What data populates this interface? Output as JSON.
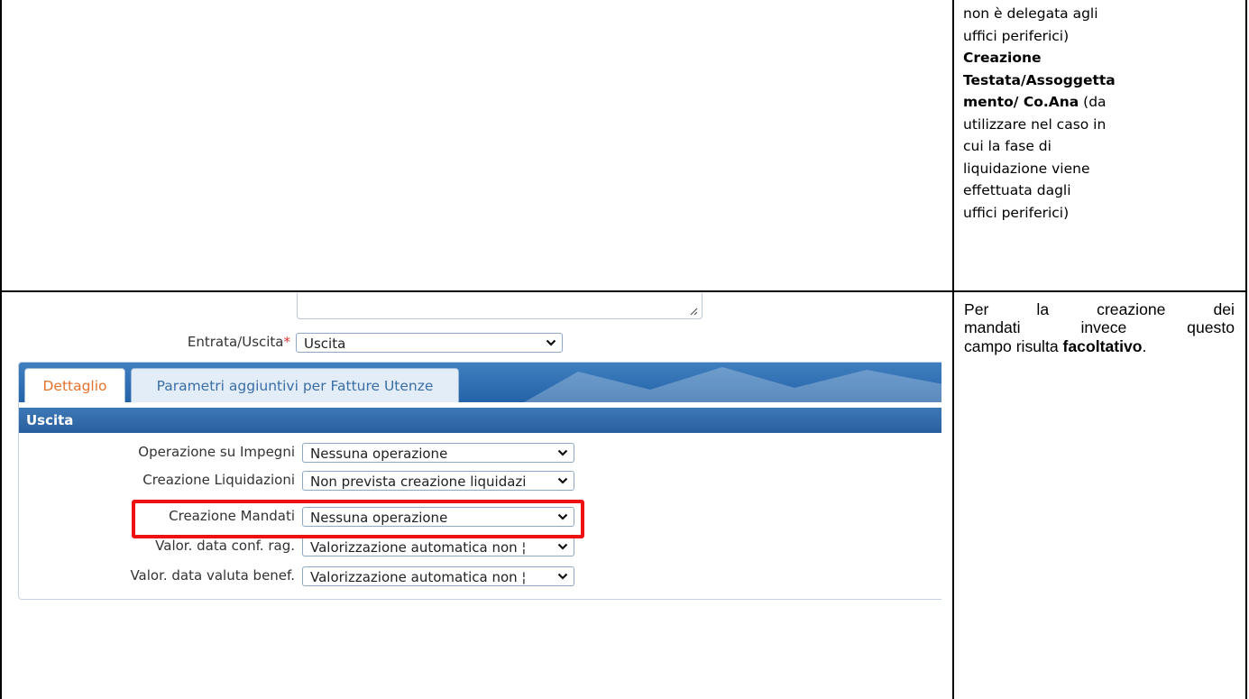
{
  "right_top": {
    "line1": "non è delegata agli",
    "line2": "uffici periferici)",
    "bold1": "Creazione",
    "bold2": "Testata/Assoggetta",
    "bold3_start": "mento/ Co.Ana",
    "line3_rest": " (da",
    "line4": "utilizzare nel caso in",
    "line5": "cui la fase di",
    "line6": "liquidazione viene",
    "line7": "effettuata dagli",
    "line8": "uffici periferici)"
  },
  "right_bottom": {
    "row1": [
      "Per",
      "la",
      "creazione",
      "dei"
    ],
    "row2": [
      "mandati",
      "invece",
      "questo"
    ],
    "row3_text": "campo risulta ",
    "row3_bold": "facoltativo",
    "row3_end": "."
  },
  "form": {
    "entrata_label": "Entrata/Uscita",
    "required_mark": "*",
    "entrata_value": "Uscita",
    "tabs": {
      "active": "Dettaglio",
      "inactive": "Parametri aggiuntivi per Fatture Utenze"
    },
    "section_title": "Uscita",
    "fields": [
      {
        "label": "Operazione su Impegni",
        "value": "Nessuna operazione"
      },
      {
        "label": "Creazione Liquidazioni",
        "value": "Non prevista creazione liquidazi"
      },
      {
        "label": "Creazione Mandati",
        "value": "Nessuna operazione"
      },
      {
        "label": "Valor. data conf. rag.",
        "value": "Valorizzazione automatica non ¦"
      },
      {
        "label": "Valor. data valuta benef.",
        "value": "Valorizzazione automatica non ¦"
      }
    ]
  },
  "colors": {
    "highlight": "#ee1111",
    "tab_active_text": "#e4722a",
    "bar_blue": "#2a63a3"
  },
  "icons": [
    "chevron-down-icon",
    "resize-grip-icon"
  ]
}
